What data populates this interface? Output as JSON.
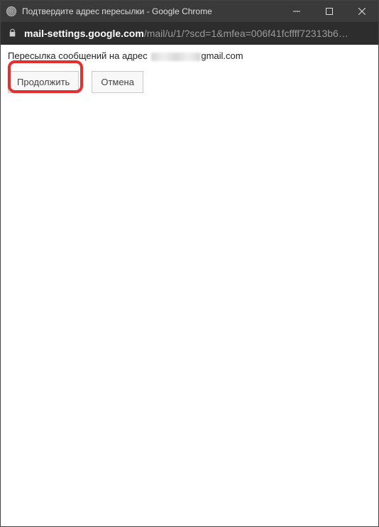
{
  "titlebar": {
    "title": "Подтвердите адрес пересылки - Google Chrome"
  },
  "addressbar": {
    "host": "mail-settings.google.com",
    "path": "/mail/u/1/?scd=1&mfea=006f41fcffff72313b6…"
  },
  "content": {
    "message_prefix": "Пересылка сообщений на адрес",
    "message_suffix": "gmail.com",
    "continue_label": "Продолжить",
    "cancel_label": "Отмена"
  }
}
